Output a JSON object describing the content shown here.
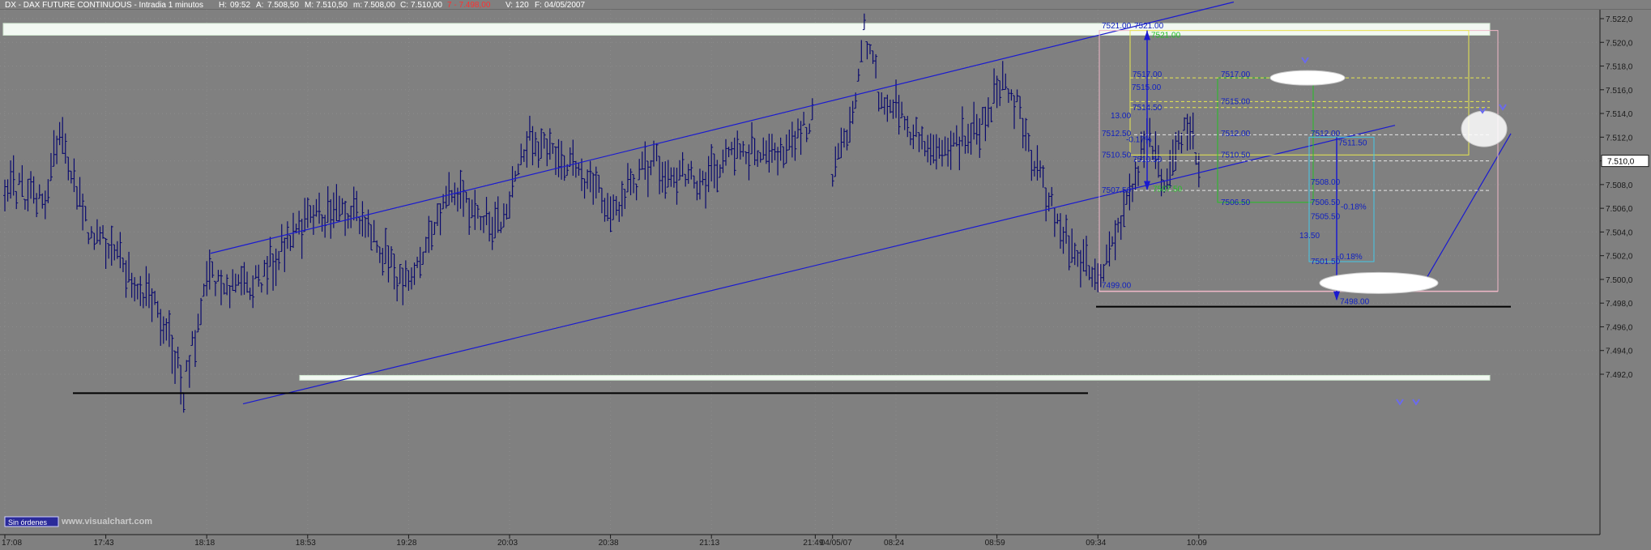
{
  "header": {
    "symbol": "DX - DAX FUTURE CONTINUOUS - Intradia 1 minutos",
    "h_label": "H:",
    "h_value": "09:52",
    "a_label": "A:",
    "a_value": "7.508,50",
    "m1_label": "M:",
    "m1_value": "7.510,50",
    "m2_label": "m:",
    "m2_value": "7.508,00",
    "c_label": "C:",
    "c_value": "7.510,00",
    "red_value": "7 - 7.498,00",
    "v_label": "V:",
    "v_value": "120",
    "f_label": "F:",
    "f_value": "04/05/2007"
  },
  "colors": {
    "background": "#808080",
    "bars": "#0a0a6e",
    "channel": "#1a1ad0",
    "white_box": "#f2f8f2",
    "green": "#24c024",
    "yellow": "#e8e850",
    "pink": "#f0b8c8",
    "cyan": "#44c8e8",
    "label_blue": "#1020c0"
  },
  "footer": {
    "orders_button": "Sin órdenes",
    "watermark": "www.visualchart.com"
  },
  "chart_data": {
    "type": "ohlc",
    "title": "DX - DAX FUTURE CONTINUOUS - Intradia 1 minutos",
    "ylim": [
      7490.0,
      7523.0
    ],
    "y_ticks": [
      7522.0,
      7520.0,
      7518.0,
      7516.0,
      7514.0,
      7512.0,
      7510.0,
      7508.0,
      7506.0,
      7504.0,
      7502.0,
      7500.0,
      7498.0,
      7496.0,
      7494.0,
      7492.0
    ],
    "y_tick_labels": [
      "7.522,0",
      "7.520,0",
      "7.518,0",
      "7.516,0",
      "7.514,0",
      "7.512,0",
      "7.510,0",
      "7.508,0",
      "7.506,0",
      "7.504,0",
      "7.502,0",
      "7.500,0",
      "7.498,0",
      "7.496,0",
      "7.494,0",
      "7.492,0"
    ],
    "last_price_label": "7.510,0",
    "last_price": 7510.0,
    "x_tick_labels": [
      "17:08",
      "17:43",
      "18:18",
      "18:53",
      "19:28",
      "20:03",
      "20:38",
      "21:13",
      "21:49",
      "04/05/07",
      "08:24",
      "08:59",
      "09:34",
      "10:09"
    ],
    "x_ticks_session": [
      0,
      35,
      70,
      105,
      140,
      175,
      210,
      245,
      281,
      287,
      309,
      344,
      379,
      414
    ],
    "session1_anchors": [
      [
        0,
        7508.0
      ],
      [
        14,
        7506.5
      ],
      [
        19,
        7513.0
      ],
      [
        28,
        7504.5
      ],
      [
        42,
        7501.0
      ],
      [
        56,
        7496.0
      ],
      [
        62,
        7490.5
      ],
      [
        70,
        7500.0
      ],
      [
        85,
        7499.0
      ],
      [
        100,
        7504.0
      ],
      [
        115,
        7506.0
      ],
      [
        125,
        7505.0
      ],
      [
        138,
        7499.0
      ],
      [
        155,
        7508.0
      ],
      [
        170,
        7504.0
      ],
      [
        182,
        7512.0
      ],
      [
        194,
        7510.0
      ],
      [
        210,
        7506.0
      ],
      [
        225,
        7510.0
      ],
      [
        240,
        7508.0
      ],
      [
        255,
        7511.0
      ],
      [
        270,
        7510.5
      ],
      [
        281,
        7514.0
      ]
    ],
    "session2_anchors": [
      [
        281,
        7510.0
      ],
      [
        288,
        7509.0
      ],
      [
        294,
        7514.0
      ],
      [
        298,
        7521.0
      ],
      [
        303,
        7516.0
      ],
      [
        313,
        7513.0
      ],
      [
        322,
        7510.0
      ],
      [
        338,
        7513.0
      ],
      [
        346,
        7517.0
      ],
      [
        352,
        7514.0
      ],
      [
        358,
        7509.0
      ],
      [
        364,
        7505.5
      ],
      [
        372,
        7501.5
      ],
      [
        380,
        7500.5
      ],
      [
        388,
        7505.0
      ],
      [
        396,
        7512.0
      ],
      [
        402,
        7508.0
      ],
      [
        410,
        7513.0
      ],
      [
        414,
        7510.0
      ]
    ],
    "session2_start_index": 281,
    "annotations": {
      "range_high": "7521.00",
      "range_high2": "7521.00",
      "range_high_green": "7521.00",
      "labels_left": [
        "7517.00",
        "7515.00",
        "7514.50",
        "13.00",
        "7512.50",
        "-0.17%",
        "7510.50",
        "7510.50",
        "7507.50",
        "7507.50"
      ],
      "labels_mid": [
        "7517.00",
        "7515.00",
        "7512.00",
        "7510.50",
        "7506.50"
      ],
      "labels_right": [
        "7512.00",
        "7511.50",
        "7508.00",
        "7506.50",
        "-0.18%",
        "7505.50",
        "13.50",
        "-0.18%",
        "7501.50"
      ],
      "low_left": "7499.00",
      "low_arrow": "7498.00"
    }
  }
}
